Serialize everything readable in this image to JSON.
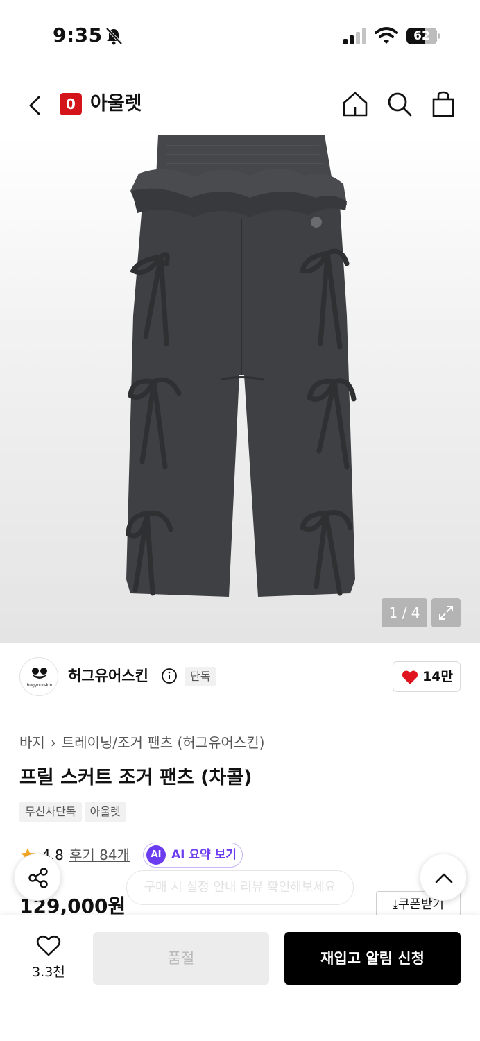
{
  "status_bar": {
    "time": "9:35",
    "battery": "62",
    "battery_level": 0.62
  },
  "header": {
    "logo_letter": "0",
    "title": "아울렛"
  },
  "gallery": {
    "page_indicator": "1 / 4"
  },
  "brand": {
    "name": "허그유어스킨",
    "avatar_text": "hugyourskin",
    "exclusive_badge": "단독",
    "like_count": "14만"
  },
  "breadcrumb": {
    "category": "바지",
    "subcategory": "트레이닝/조거 팬츠 (허그유어스킨)"
  },
  "product": {
    "title": "프릴 스커트 조거 팬츠 (차콜)",
    "tags": [
      "무신사단독",
      "아울렛"
    ],
    "rating": "4.8",
    "reviews": "후기 84개",
    "ai_badge": "AI",
    "ai_label": "AI 요약 보기",
    "floating_hint": "구매 시 설정 안내 리뷰 확인해보세요",
    "price": "129,000원",
    "coupon_label": "쿠폰받기"
  },
  "bottom_bar": {
    "wish_count": "3.3천",
    "soldout_label": "품절",
    "restock_label": "재입고 알림 신청"
  },
  "colors": {
    "brand_red": "#d3151b",
    "ai_purple": "#6c3df0",
    "like_red": "#e0141e",
    "star": "#f5a623"
  }
}
